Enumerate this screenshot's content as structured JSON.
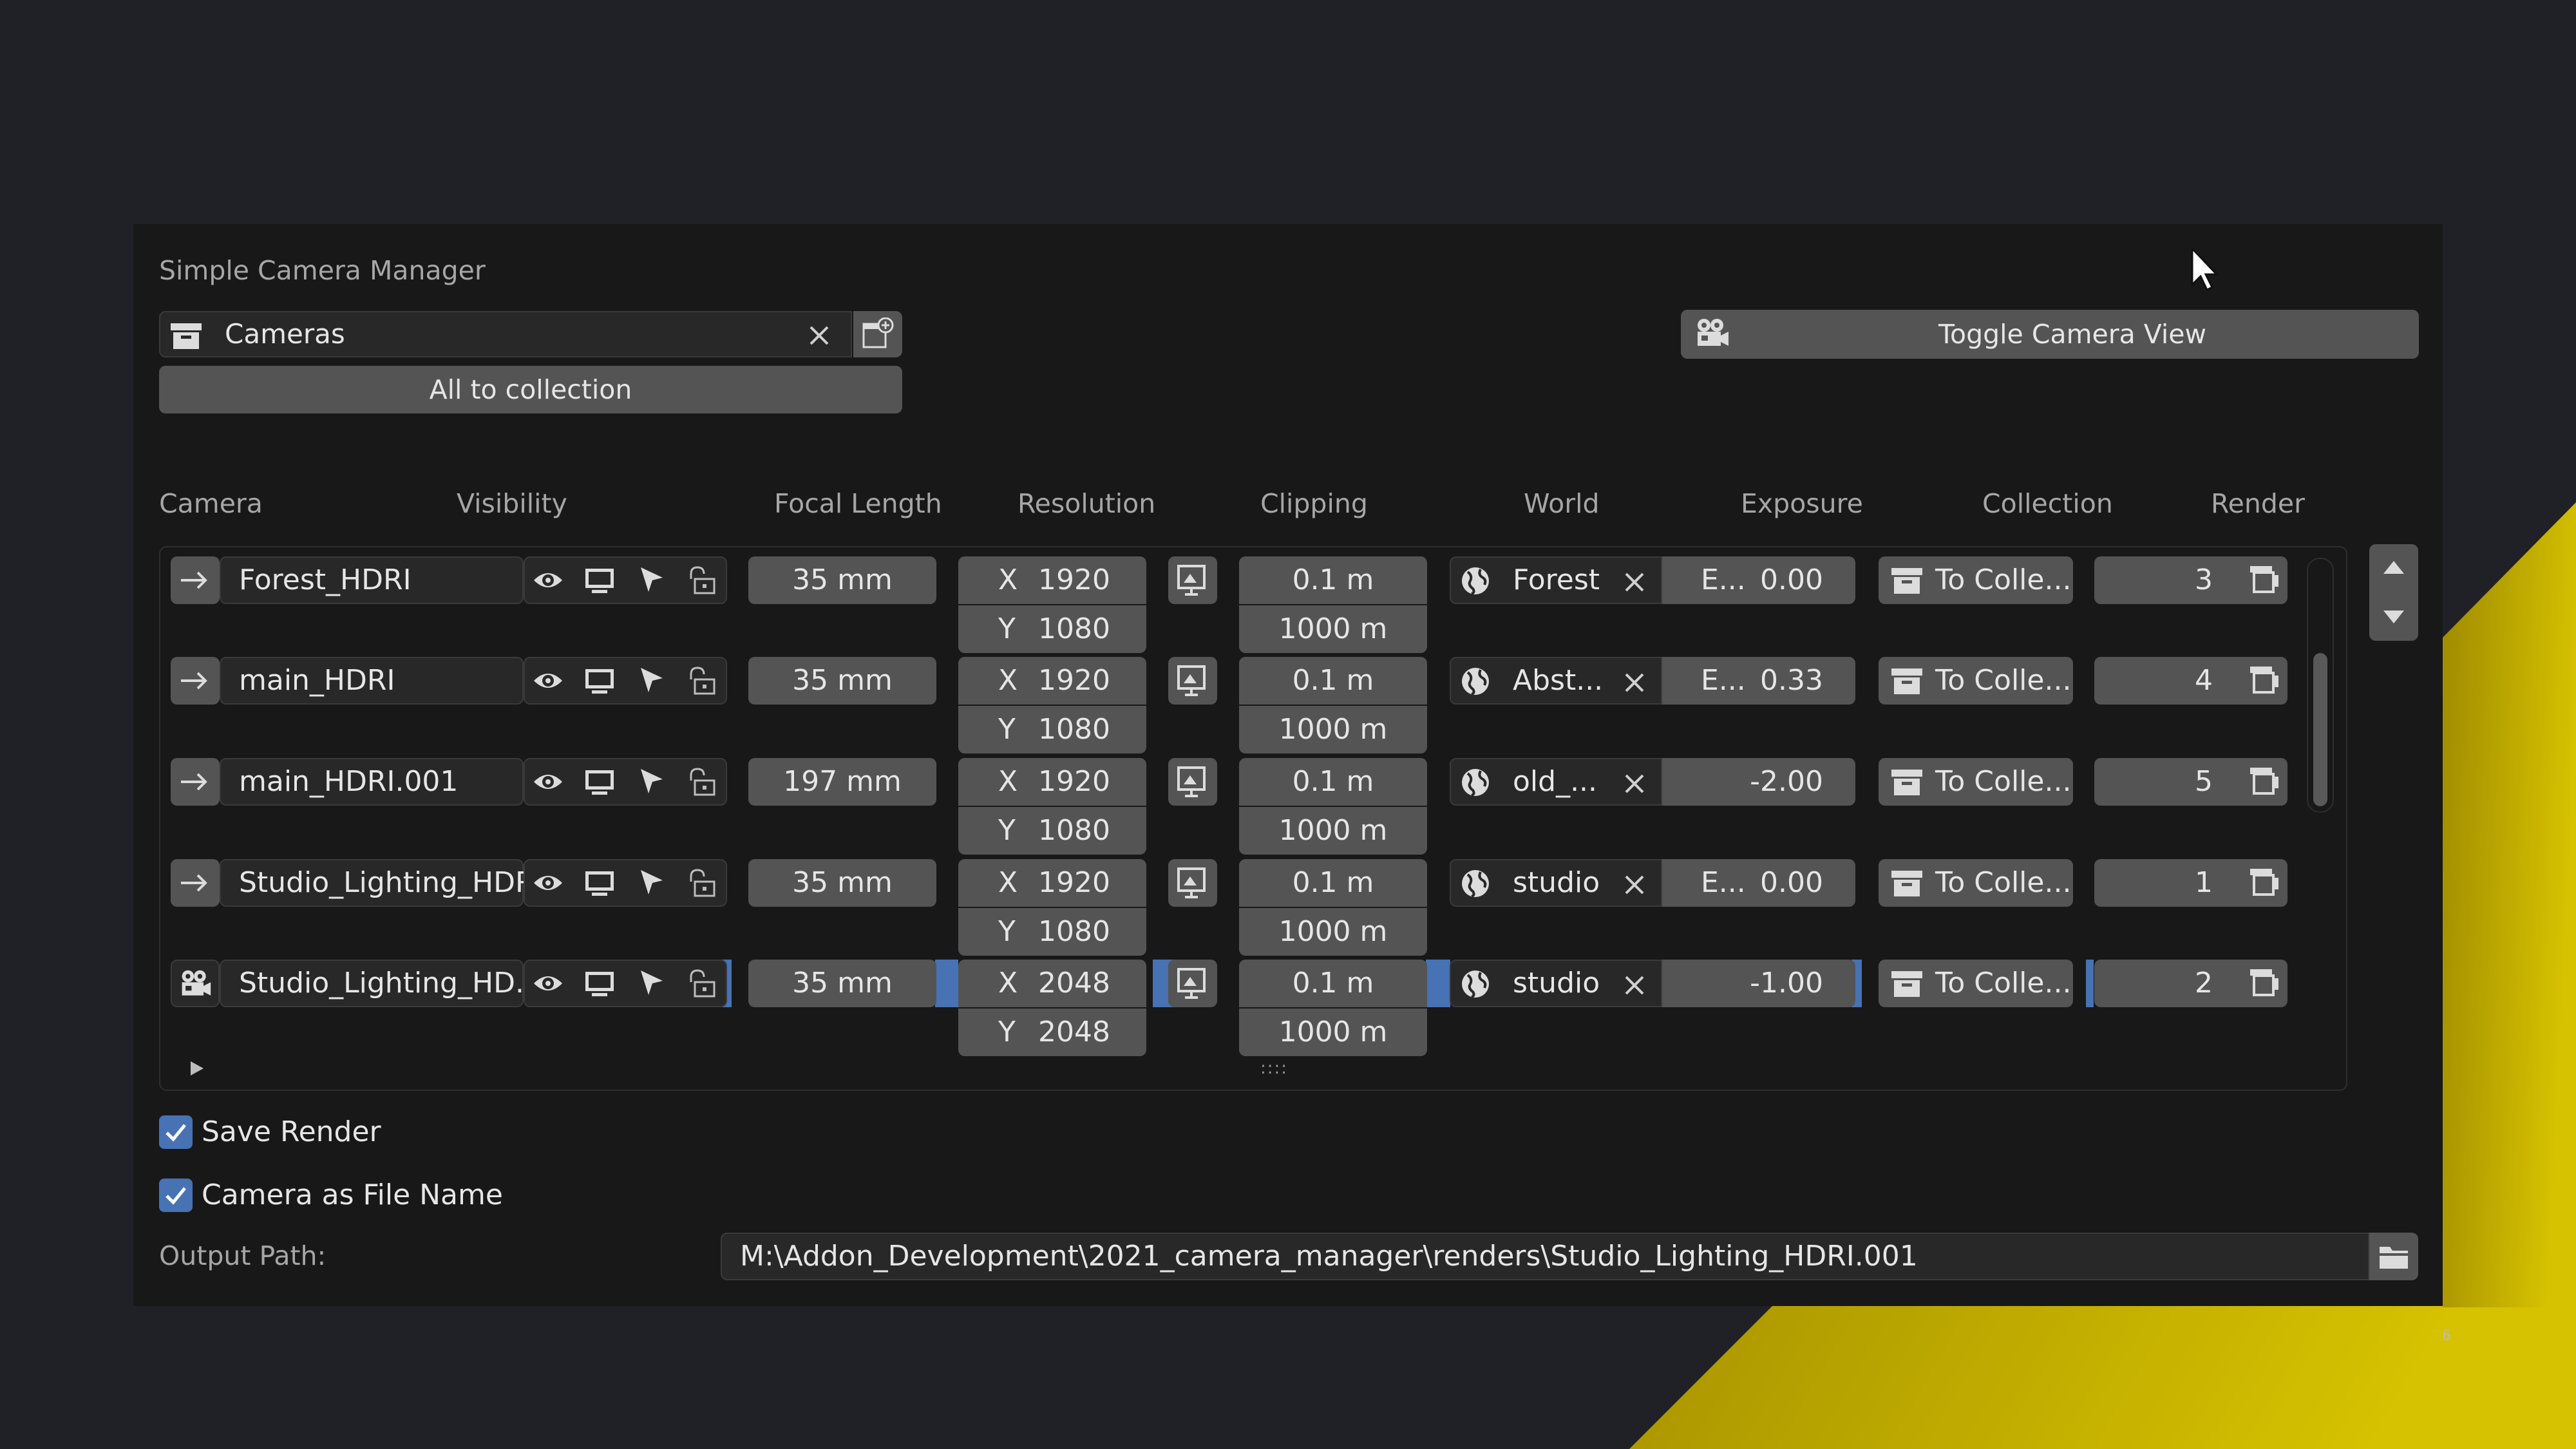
{
  "page": {
    "slide_number": "6"
  },
  "panel": {
    "title": "Simple Camera Manager",
    "collection_field": {
      "value": "Cameras"
    },
    "all_to_collection_label": "All to collection",
    "toggle_camera_view_label": "Toggle Camera View"
  },
  "columns": [
    "Camera",
    "Visibility",
    "Focal Length",
    "Resolution",
    "Clipping",
    "World",
    "Exposure",
    "Collection",
    "Render"
  ],
  "cameras": [
    {
      "name": "Forest_HDRI",
      "focal": "35 mm",
      "res_x": "1920",
      "res_y": "1080",
      "clip_start": "0.1 m",
      "clip_end": "1000 m",
      "world": "Forest",
      "exposure_prefix": "E...",
      "exposure": "0.00",
      "collection": "To Colle...",
      "render": "3",
      "active": false
    },
    {
      "name": "main_HDRI",
      "focal": "35 mm",
      "res_x": "1920",
      "res_y": "1080",
      "clip_start": "0.1 m",
      "clip_end": "1000 m",
      "world": "Abst...",
      "exposure_prefix": "E...",
      "exposure": "0.33",
      "collection": "To Colle...",
      "render": "4",
      "active": false
    },
    {
      "name": "main_HDRI.001",
      "focal": "197 mm",
      "res_x": "1920",
      "res_y": "1080",
      "clip_start": "0.1 m",
      "clip_end": "1000 m",
      "world": "old_...",
      "exposure_prefix": "",
      "exposure": "-2.00",
      "collection": "To Colle...",
      "render": "5",
      "active": false
    },
    {
      "name": "Studio_Lighting_HDRI",
      "focal": "35 mm",
      "res_x": "1920",
      "res_y": "1080",
      "clip_start": "0.1 m",
      "clip_end": "1000 m",
      "world": "studio",
      "exposure_prefix": "E...",
      "exposure": "0.00",
      "collection": "To Colle...",
      "render": "1",
      "active": false
    },
    {
      "name": "Studio_Lighting_HD...",
      "focal": "35 mm",
      "res_x": "2048",
      "res_y": "2048",
      "clip_start": "0.1 m",
      "clip_end": "1000 m",
      "world": "studio",
      "exposure_prefix": "",
      "exposure": "-1.00",
      "collection": "To Colle...",
      "render": "2",
      "active": true
    }
  ],
  "axis_labels": {
    "x": "X",
    "y": "Y"
  },
  "options": {
    "save_render": {
      "label": "Save Render",
      "checked": true
    },
    "camera_as_file_name": {
      "label": "Camera as File Name",
      "checked": true
    }
  },
  "output": {
    "label": "Output Path:",
    "path": "M:\\Addon_Development\\2021_camera_manager\\renders\\Studio_Lighting_HDRI.001"
  },
  "colors": {
    "accent": "#4772b3",
    "button": "#545454",
    "field": "#282828",
    "panel": "#181818",
    "background": "#1f2126",
    "decor": "#c9b200"
  },
  "icons": [
    "collection-icon",
    "clear-icon",
    "add-collection-icon",
    "camera-icon",
    "arrow-right-icon",
    "eye-icon",
    "monitor-icon",
    "cursor-icon",
    "lock-icon",
    "screen-icon",
    "globe-icon",
    "render-icon",
    "folder-icon",
    "triangle-up-icon",
    "triangle-down-icon",
    "check-icon"
  ]
}
